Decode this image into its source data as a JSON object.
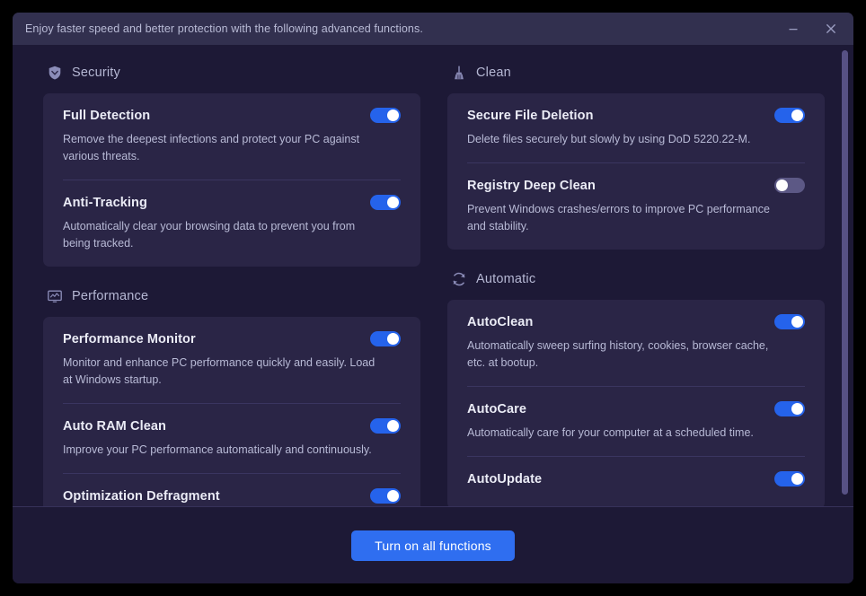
{
  "window": {
    "title": "Enjoy faster speed and better protection with the following advanced functions.",
    "minimize_label": "Minimize",
    "close_label": "Close"
  },
  "footer": {
    "cta_label": "Turn on all functions"
  },
  "colors": {
    "accent_on": "#2563eb",
    "accent_off": "#5c5885",
    "cta": "#2f6ef0",
    "card_bg": "#2a2546",
    "page_bg": "#1d1936",
    "titlebar_bg": "#32304f",
    "scrollbar_thumb": "#575184"
  },
  "columns": [
    {
      "sections": [
        {
          "title": "Security",
          "icon": "shield-icon",
          "features": [
            {
              "name": "Full Detection",
              "desc": "Remove the deepest infections and protect your PC against various threats.",
              "toggle": "on"
            },
            {
              "name": "Anti-Tracking",
              "desc": "Automatically clear your browsing data to prevent you from being tracked.",
              "toggle": "on"
            }
          ]
        },
        {
          "title": "Performance",
          "icon": "performance-monitor-icon",
          "features": [
            {
              "name": "Performance Monitor",
              "desc": "Monitor and enhance PC performance quickly and easily. Load at Windows startup.",
              "toggle": "on"
            },
            {
              "name": "Auto RAM Clean",
              "desc": "Improve your PC performance automatically and continuously.",
              "toggle": "on"
            },
            {
              "name": "Optimization Defragment",
              "desc": "",
              "toggle": "on"
            }
          ]
        }
      ]
    },
    {
      "sections": [
        {
          "title": "Clean",
          "icon": "broom-icon",
          "features": [
            {
              "name": "Secure File Deletion",
              "desc": "Delete files securely but slowly by using DoD 5220.22-M.",
              "toggle": "on"
            },
            {
              "name": "Registry Deep Clean",
              "desc": "Prevent Windows crashes/errors to improve PC performance and stability.",
              "toggle": "off"
            }
          ]
        },
        {
          "title": "Automatic",
          "icon": "refresh-icon",
          "features": [
            {
              "name": "AutoClean",
              "desc": "Automatically sweep surfing history, cookies, browser cache, etc. at bootup.",
              "toggle": "on"
            },
            {
              "name": "AutoCare",
              "desc": "Automatically care for your computer at a scheduled time.",
              "toggle": "on"
            },
            {
              "name": "AutoUpdate",
              "desc": "",
              "toggle": "on"
            }
          ]
        }
      ]
    }
  ]
}
